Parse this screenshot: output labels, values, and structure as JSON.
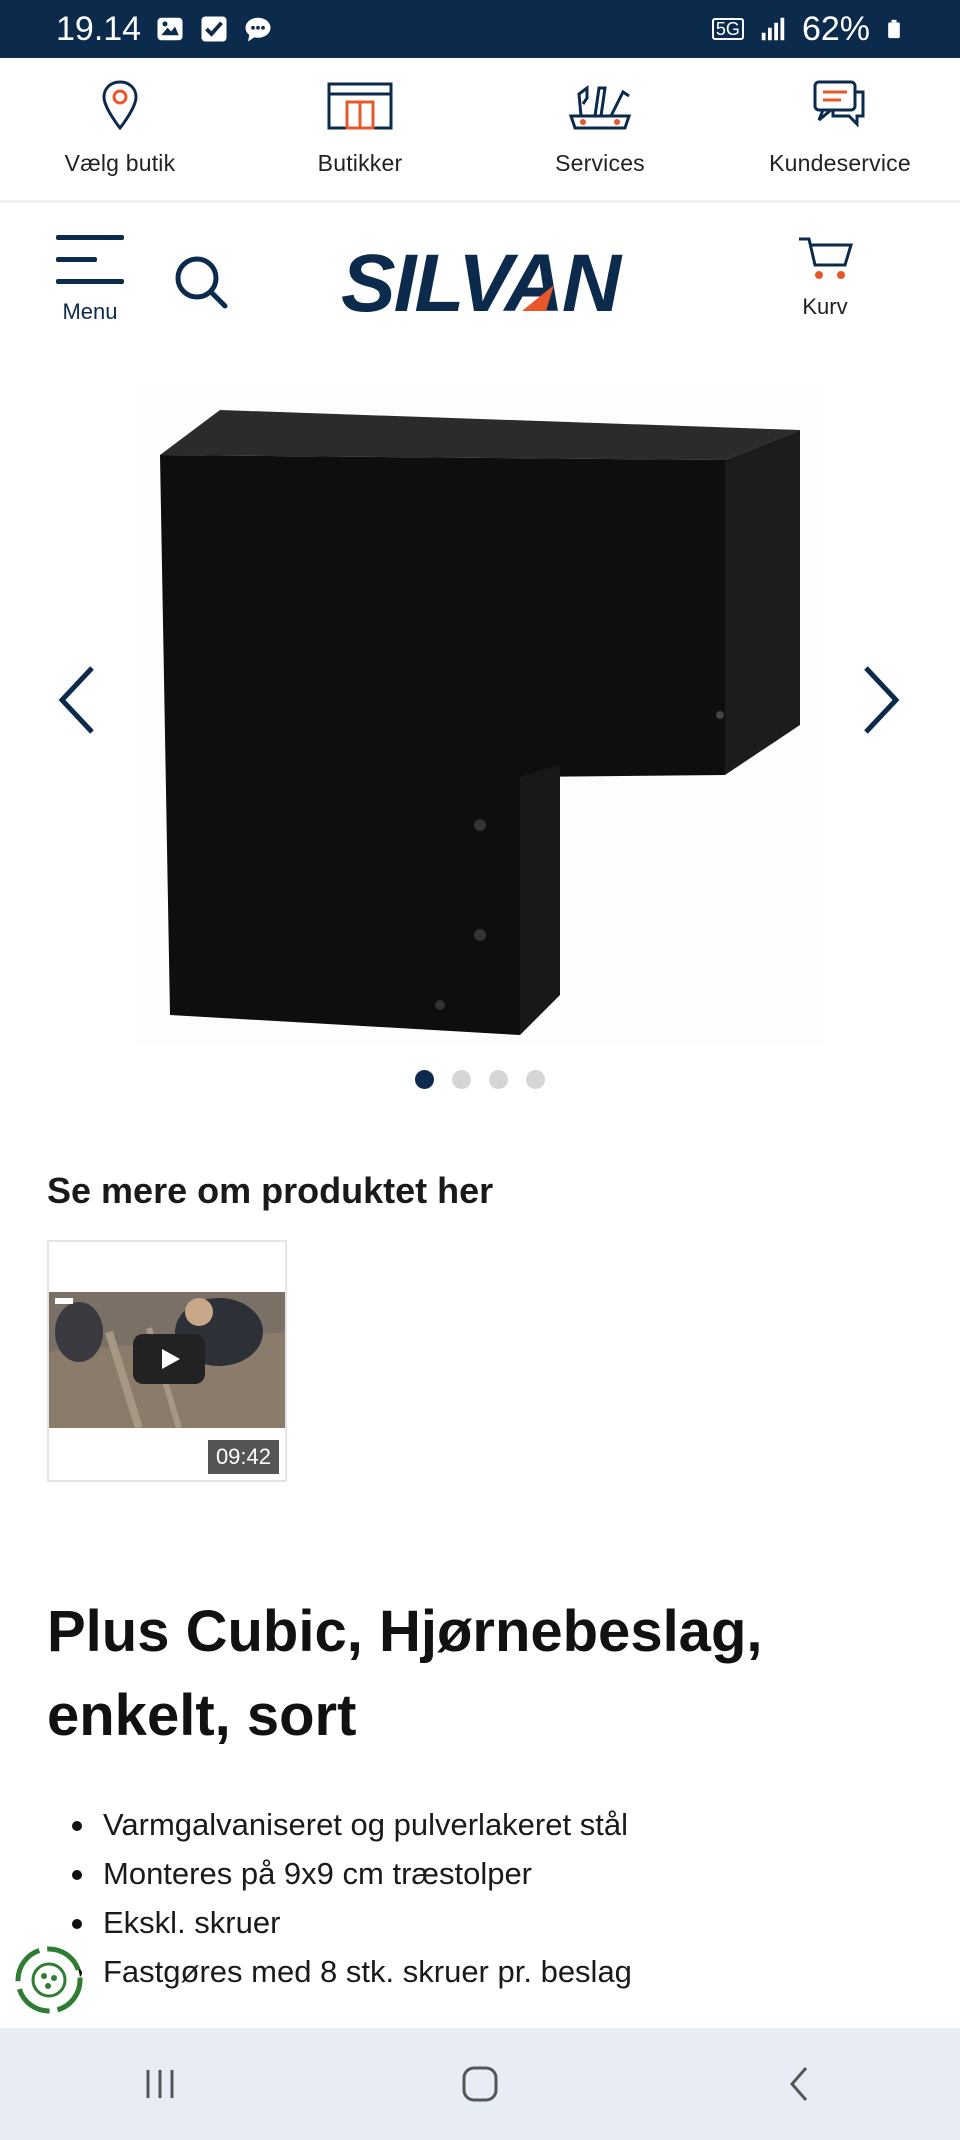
{
  "status_bar": {
    "time": "19.14",
    "network": "5G",
    "battery": "62%"
  },
  "top_nav": {
    "items": [
      {
        "label": "Vælg butik",
        "icon": "map-pin-icon"
      },
      {
        "label": "Butikker",
        "icon": "store-icon"
      },
      {
        "label": "Services",
        "icon": "tools-icon"
      },
      {
        "label": "Kundeservice",
        "icon": "chat-icon"
      }
    ]
  },
  "header": {
    "menu_label": "Menu",
    "logo_text": "SILVAN",
    "cart_label": "Kurv"
  },
  "gallery": {
    "image_count": 4,
    "active_index": 0
  },
  "video": {
    "heading": "Se mere om produktet her",
    "duration": "09:42"
  },
  "product": {
    "title": "Plus Cubic, Hjørnebeslag, enkelt, sort",
    "features": [
      "Varmgalvaniseret og pulverlakeret stål",
      "Monteres på 9x9 cm træstolper",
      "Ekskl. skruer",
      "Fastgøres med 8 stk. skruer pr. beslag"
    ]
  },
  "colors": {
    "brand_navy": "#0b2a4c",
    "accent_orange": "#e8572a"
  }
}
